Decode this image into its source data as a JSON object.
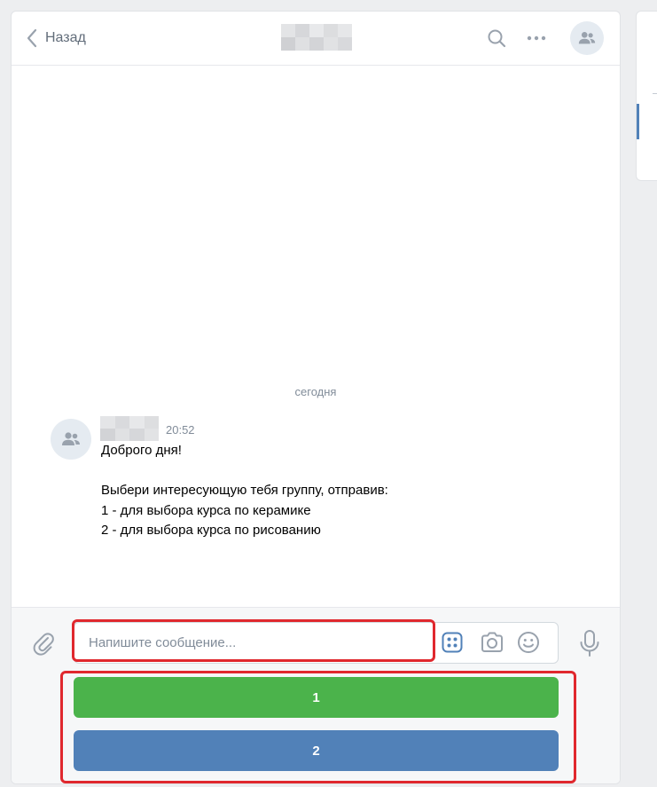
{
  "header": {
    "back_label": "Назад",
    "icons": [
      "chevron-left-icon",
      "search-icon",
      "more-icon",
      "group-avatar-icon"
    ]
  },
  "chat": {
    "date_divider": "сегодня",
    "message": {
      "time": "20:52",
      "lines": [
        "Доброго дня!",
        "",
        "Выбери интересующую тебя группу, отправив:",
        "1 - для выбора курса по керамике",
        "2 - для выбора курса по рисованию"
      ]
    }
  },
  "composer": {
    "placeholder": "Напишите сообщение...",
    "value": "",
    "icons": [
      "paperclip-icon",
      "keyboard-icon",
      "camera-icon",
      "emoji-icon",
      "microphone-icon"
    ]
  },
  "keyboard": {
    "buttons": [
      {
        "label": "1",
        "color": "#4bb34b"
      },
      {
        "label": "2",
        "color": "#5181b8"
      }
    ]
  },
  "colors": {
    "highlight": "#e0282e",
    "accent": "#5181b8",
    "positive": "#4bb34b"
  }
}
